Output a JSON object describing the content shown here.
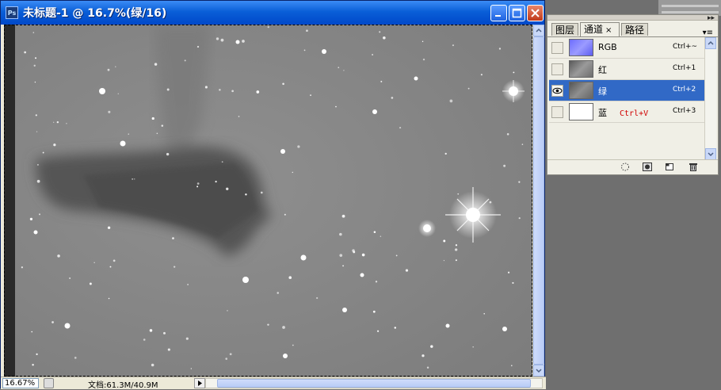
{
  "window": {
    "title": "未标题-1 @ 16.7%(绿/16)",
    "app_icon_label": "Ps",
    "icons": [
      "minimize-icon",
      "maximize-icon",
      "close-icon"
    ]
  },
  "status_bar": {
    "zoom": "16.67%",
    "doc_size": "文档:61.3M/40.9M"
  },
  "panel": {
    "tabs": [
      {
        "label": "图层"
      },
      {
        "label": "通道",
        "active": true,
        "close": "×"
      },
      {
        "label": "路径"
      }
    ],
    "collapse_glyph": "▸▸",
    "menu_glyph": "▾≡",
    "channels": [
      {
        "name": "RGB",
        "shortcut": "Ctrl+~",
        "visible": false
      },
      {
        "name": "红",
        "shortcut": "Ctrl+1",
        "visible": false
      },
      {
        "name": "绿",
        "shortcut": "Ctrl+2",
        "visible": true,
        "selected": true
      },
      {
        "name": "蓝",
        "shortcut": "Ctrl+3",
        "visible": false,
        "note": "Ctrl+V"
      }
    ],
    "footer_icons": [
      "load-selection-icon",
      "save-selection-icon",
      "new-channel-icon",
      "delete-icon"
    ]
  },
  "colors": {
    "titlebar": "#0a5fd8",
    "selected_row": "#3169c6",
    "note_red": "#d00000",
    "canvas_gray": "#8a8a8a"
  }
}
